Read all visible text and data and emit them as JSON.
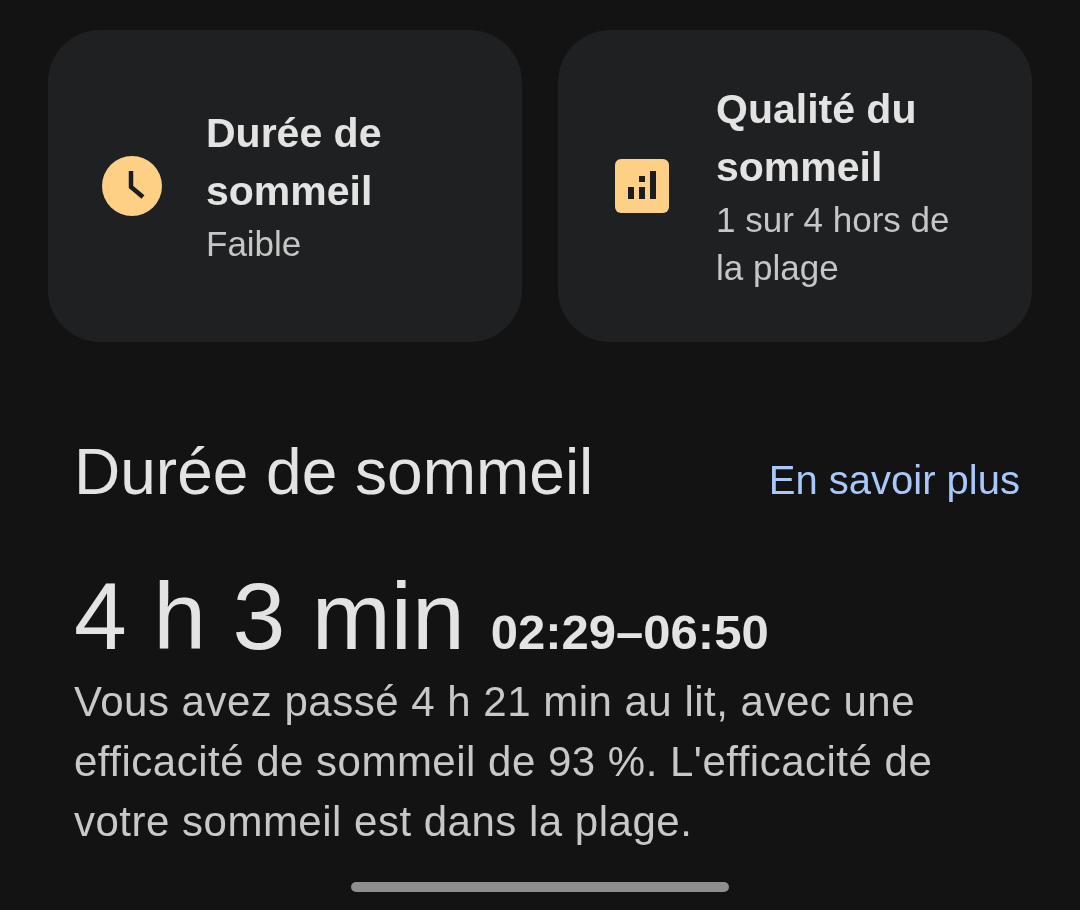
{
  "cards": [
    {
      "kind": "clock",
      "title": "Durée de sommeil",
      "subtitle": "Faible"
    },
    {
      "kind": "bars",
      "title": "Qualité du sommeil",
      "subtitle": "1 sur 4 hors de la plage"
    }
  ],
  "section": {
    "title": "Durée de sommeil",
    "link": "En savoir plus",
    "duration": "4 h 3 min",
    "time_range": "02:29–06:50",
    "description": "Vous avez passé 4 h 21 min au lit, avec une efficacité de sommeil de 93 %. L'efficacité de votre sommeil est dans la plage."
  }
}
